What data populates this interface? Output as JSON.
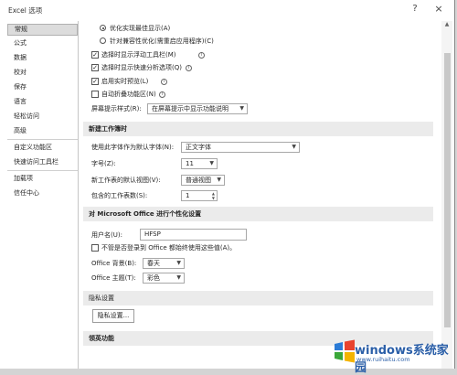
{
  "window": {
    "title": "Excel 选项",
    "help_label": "?",
    "close_label": "×"
  },
  "nav": {
    "items": [
      {
        "label": "常规",
        "selected": true
      },
      {
        "label": "公式"
      },
      {
        "label": "数据"
      },
      {
        "label": "校对"
      },
      {
        "label": "保存"
      },
      {
        "label": "语言"
      },
      {
        "label": "轻松访问"
      },
      {
        "label": "高级"
      },
      {
        "label": "自定义功能区"
      },
      {
        "label": "快速访问工具栏"
      },
      {
        "label": "加载项"
      },
      {
        "label": "信任中心"
      }
    ]
  },
  "ui_options": {
    "radio_optimize_display": "优化实现最佳显示(A)",
    "radio_optimize_compat": "针对兼容性优化(需重启应用程序)(C)",
    "check_mini_toolbar": "选择时显示浮动工具栏(M)",
    "check_quick_analysis": "选择时显示快速分析选项(Q)",
    "check_live_preview": "启用实时预览(L)",
    "check_collapse_ribbon": "自动折叠功能区(N)",
    "screentip_label": "屏幕提示样式(R):",
    "screentip_value": "在屏幕提示中显示功能说明"
  },
  "new_workbook": {
    "header": "新建工作簿时",
    "font_label": "使用此字体作为默认字体(N):",
    "font_value": "正文字体",
    "size_label": "字号(Z):",
    "size_value": "11",
    "view_label": "新工作表的默认视图(V):",
    "view_value": "普通视图",
    "sheets_label": "包含的工作表数(S):",
    "sheets_value": "1"
  },
  "personalize": {
    "header": "对 Microsoft Office 进行个性化设置",
    "username_label": "用户名(U):",
    "username_value": "HFSP",
    "always_use_label": "不管是否登录到 Office 都始终使用这些值(A)。",
    "background_label": "Office 背景(B):",
    "background_value": "春天",
    "theme_label": "Office 主题(T):",
    "theme_value": "彩色"
  },
  "privacy": {
    "header": "隐私设置",
    "button_label": "隐私设置..."
  },
  "next_section": {
    "header": "领英功能"
  },
  "watermark": {
    "text": "windows系统家园",
    "sub": "www.ruihaitu.com"
  }
}
